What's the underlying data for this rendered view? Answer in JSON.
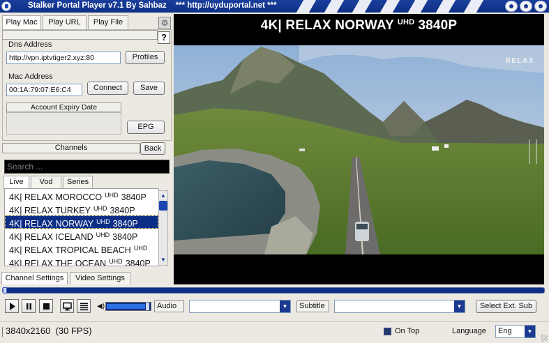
{
  "window": {
    "title": "Stalker Portal Player v7.1 By Sahbaz",
    "subtitle": "*** http://uyduportal.net ***"
  },
  "top_tabs": [
    "Play Mac",
    "Play URL",
    "Play File"
  ],
  "help_label": "?",
  "dns": {
    "label": "Dns Address",
    "value": "http://vpn.iptvtiger2.xyz:80",
    "profiles_button": "Profiles"
  },
  "mac": {
    "label": "Mac Address",
    "value": "00:1A:79:07:E6:C4",
    "connect_button": "Connect",
    "save_button": "Save"
  },
  "account": {
    "expiry_label": "Account Expiry Date",
    "epg_button": "EPG"
  },
  "channels": {
    "header": "Channels",
    "back_button": "Back",
    "search_placeholder": "Search ...",
    "tabs": [
      "Live",
      "Vod",
      "Series"
    ],
    "items": [
      {
        "name": "4K| RELAX MOROCCO",
        "uhd": "UHD",
        "res": "3840P",
        "selected": false
      },
      {
        "name": "4K| RELAX TURKEY",
        "uhd": "UHD",
        "res": "3840P",
        "selected": false
      },
      {
        "name": "4K| RELAX NORWAY",
        "uhd": "UHD",
        "res": "3840P",
        "selected": true
      },
      {
        "name": "4K| RELAX ICELAND",
        "uhd": "UHD",
        "res": "3840P",
        "selected": false
      },
      {
        "name": "4K| RELAX TROPICAL BEACH",
        "uhd": "UHD",
        "res": "",
        "selected": false
      },
      {
        "name": "4K| RELAX THE OCEAN",
        "uhd": "UHD",
        "res": "3840P",
        "selected": false
      }
    ]
  },
  "bottom_tabs": [
    "Channel Settings",
    "Video Settings"
  ],
  "video": {
    "title_prefix": "4K| RELAX NORWAY",
    "title_uhd": "UHD",
    "title_res": "3840P",
    "watermark": "RELAX"
  },
  "playback": {
    "progress": 0.0,
    "volume": 0.95
  },
  "controls": {
    "audio_label": "Audio",
    "subtitle_label": "Subtitle",
    "select_ext_sub_button": "Select Ext. Sub"
  },
  "status": {
    "resolution": "3840x2160",
    "fps": "(30 FPS)",
    "on_top_label": "On Top",
    "on_top_checked": true,
    "language_label": "Language",
    "language_value": "Eng"
  },
  "colors": {
    "titlebar": "#0f2f85",
    "selection": "#0d2e86",
    "accent": "#1c3a92"
  },
  "icons": [
    "play-icon",
    "pause-icon",
    "stop-icon",
    "monitor-icon",
    "playlist-icon",
    "speaker-icon",
    "gear-icon",
    "chevron-down-icon"
  ]
}
